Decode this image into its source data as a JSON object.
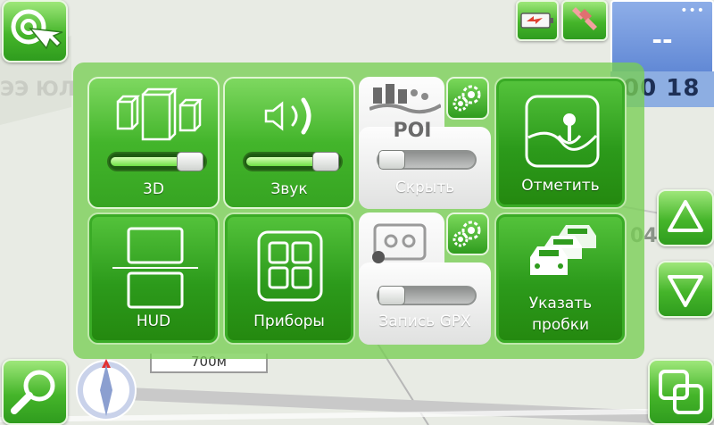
{
  "map": {
    "fragment_left": "ЭЭ ЮЛ",
    "fragment_right": "04",
    "scale_label": "700м"
  },
  "status": {
    "info_value": "--",
    "time": "00 18"
  },
  "menu": {
    "tiles": [
      {
        "id": "3d",
        "label": "3D",
        "slider_percent": 80
      },
      {
        "id": "sound",
        "label": "Звук",
        "slider_percent": 80
      },
      {
        "id": "poi",
        "title": "POI",
        "label": "Скрыть",
        "slider_percent": 0
      },
      {
        "id": "mark",
        "label": "Отметить"
      },
      {
        "id": "hud",
        "label": "HUD"
      },
      {
        "id": "gauges",
        "label": "Приборы"
      },
      {
        "id": "gpx",
        "label": "Запись GPX",
        "slider_percent": 0
      },
      {
        "id": "traffic",
        "label_line1": "Указать",
        "label_line2": "пробки"
      }
    ]
  },
  "icons": {
    "cursor": "target-cursor-icon",
    "battery": "battery-icon",
    "satellite": "satellite-icon",
    "search": "magnifier-icon",
    "compass": "compass-icon",
    "up": "arrow-up-icon",
    "down": "arrow-down-icon",
    "windows": "windows-icon"
  },
  "colors": {
    "accent_green": "#43b52b",
    "info_blue": "#6b90d9",
    "poi_grey": "#e0e1e0"
  }
}
